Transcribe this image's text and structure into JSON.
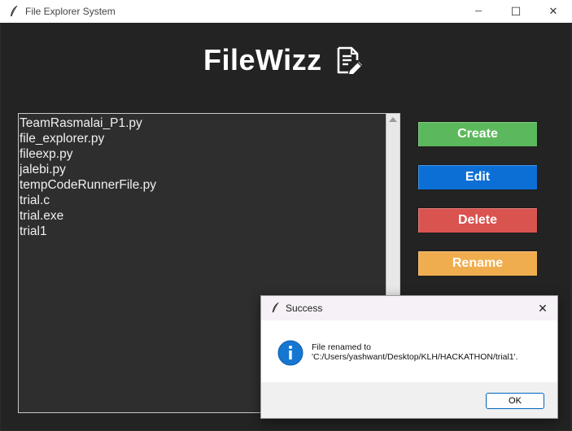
{
  "window": {
    "title": "File Explorer System",
    "controls": {
      "minimize": "─",
      "maximize": "☐",
      "close": "✕"
    }
  },
  "app": {
    "heading": "FileWizz",
    "heading_icon": "edit-document-icon"
  },
  "files": {
    "items": [
      "TeamRasmalai_P1.py",
      "file_explorer.py",
      "fileexp.py",
      "jalebi.py",
      "tempCodeRunnerFile.py",
      "trial.c",
      "trial.exe",
      "trial1"
    ]
  },
  "buttons": {
    "create": {
      "label": "Create",
      "color": "#5cb85c"
    },
    "edit": {
      "label": "Edit",
      "color": "#0b6fd6"
    },
    "delete": {
      "label": "Delete",
      "color": "#d9534f"
    },
    "rename": {
      "label": "Rename",
      "color": "#f0ad4e"
    }
  },
  "dialog": {
    "title": "Success",
    "icon": "info-icon",
    "message_line1": "File renamed to",
    "message_line2": "'C:/Users/yashwant/Desktop/KLH/HACKATHON/trial1'.",
    "ok_label": "OK",
    "close": "✕"
  }
}
